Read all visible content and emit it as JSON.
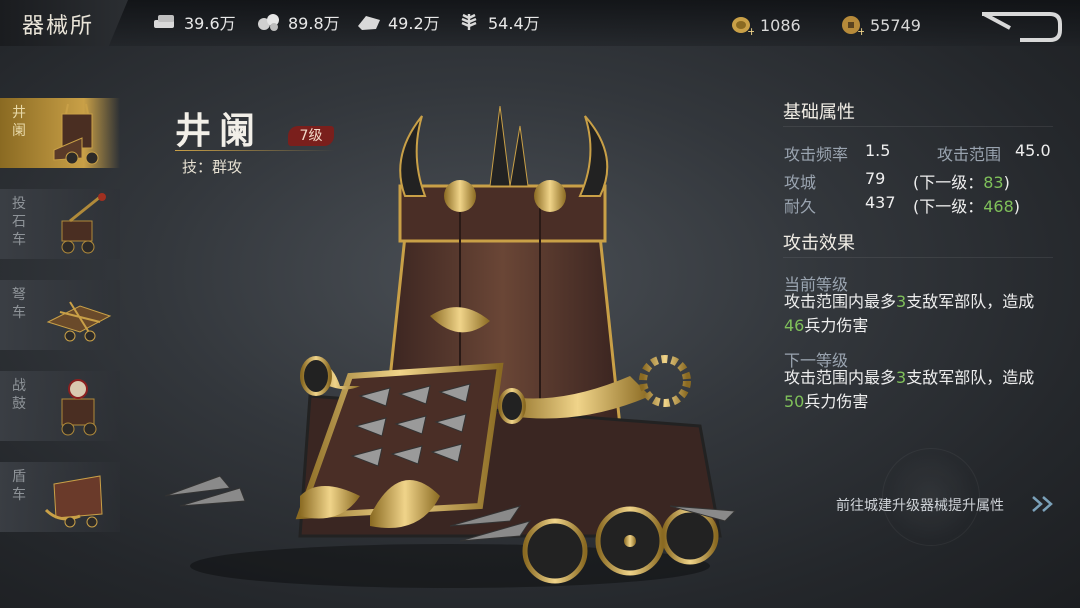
{
  "header": {
    "title": "器械所",
    "resources": [
      {
        "icon": "wood-icon",
        "value": "39.6万"
      },
      {
        "icon": "iron-icon",
        "value": "89.8万"
      },
      {
        "icon": "stone-icon",
        "value": "49.2万"
      },
      {
        "icon": "grain-icon",
        "value": "54.4万"
      }
    ],
    "gold_ingot": "1086",
    "copper_coin": "55749"
  },
  "sidebar": {
    "items": [
      {
        "label": "井阑",
        "active": true
      },
      {
        "label": "投石车",
        "active": false
      },
      {
        "label": "弩车",
        "active": false
      },
      {
        "label": "战鼓",
        "active": false
      },
      {
        "label": "盾车",
        "active": false
      }
    ]
  },
  "unit": {
    "name": "井阑",
    "level": "7级",
    "skill": "技：群攻"
  },
  "attributes": {
    "heading": "基础属性",
    "attack_rate_label": "攻击频率",
    "attack_rate_value": "1.5",
    "attack_range_label": "攻击范围",
    "attack_range_value": "45.0",
    "siege_label": "攻城",
    "siege_value": "79",
    "siege_next_prefix": "(下一级：",
    "siege_next_value": "83",
    "siege_next_suffix": ")",
    "durability_label": "耐久",
    "durability_value": "437",
    "durability_next_prefix": "(下一级：",
    "durability_next_value": "468",
    "durability_next_suffix": ")"
  },
  "effects": {
    "heading": "攻击效果",
    "current_label": "当前等级",
    "current_text_a": "攻击范围内最多",
    "current_count": "3",
    "current_text_b": "支敌军部队，造成",
    "current_damage": "46",
    "current_text_c": "兵力伤害",
    "next_label": "下一等级",
    "next_text_a": "攻击范围内最多",
    "next_count": "3",
    "next_text_b": "支敌军部队，造成",
    "next_damage": "50",
    "next_text_c": "兵力伤害"
  },
  "footer": {
    "goto_text": "前往城建升级器械提升属性"
  },
  "colors": {
    "accent_gold": "#c9a047",
    "highlight_green": "#7fc05a",
    "level_red": "#7a1f1c"
  }
}
